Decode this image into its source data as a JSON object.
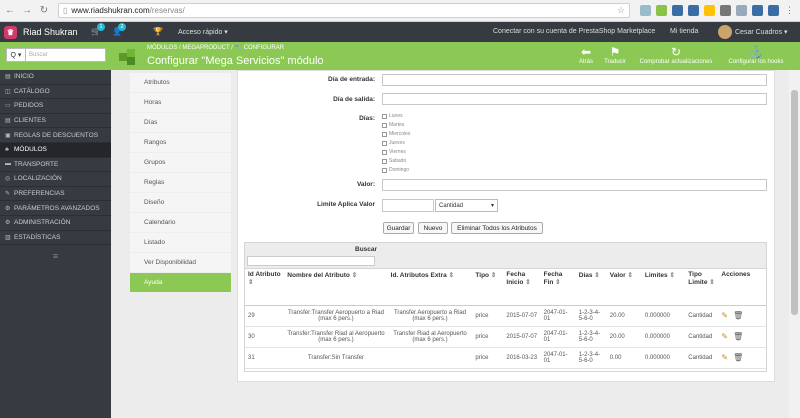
{
  "browser": {
    "url_host": "www.riadshukran.com",
    "url_path": "/reservas/"
  },
  "topbar": {
    "shop_name": "Riad Shukran",
    "cart_count": "1",
    "users_count": "2",
    "quick_access": "Acceso rápido ▾",
    "connect": "Conectar con su cuenta de PrestaShop Marketplace",
    "my_shop": "Mi tienda",
    "user_name": "Cesar Cuadros ▾"
  },
  "search": {
    "placeholder": "Buscar",
    "button": "Q ▾"
  },
  "breadcrumb": "MÓDULOS  /  MEGAPRODUCT  /  🔧 CONFIGURAR",
  "page_title": "Configurar \"Mega Servicios\" módulo",
  "toolbar": {
    "back": "Atrás",
    "translate": "Traducir",
    "check_updates": "Comprobar actualizaciones",
    "hooks": "Configurar los hooks"
  },
  "sidebar": [
    {
      "icon": "▤",
      "label": "INICIO"
    },
    {
      "icon": "◫",
      "label": "CATÁLOGO"
    },
    {
      "icon": "▭",
      "label": "PEDIDOS"
    },
    {
      "icon": "▤",
      "label": "CLIENTES"
    },
    {
      "icon": "▣",
      "label": "REGLAS DE DESCUENTOS"
    },
    {
      "icon": "♣",
      "label": "MÓDULOS"
    },
    {
      "icon": "▬",
      "label": "TRANSPORTE"
    },
    {
      "icon": "◎",
      "label": "LOCALIZACIÓN"
    },
    {
      "icon": "✎",
      "label": "PREFERENCIAS"
    },
    {
      "icon": "⚙",
      "label": "PARÁMETROS AVANZADOS"
    },
    {
      "icon": "⚙",
      "label": "ADMINISTRACIÓN"
    },
    {
      "icon": "▥",
      "label": "ESTADÍSTICAS"
    }
  ],
  "tabs": [
    "Atributos",
    "Horas",
    "Días",
    "Rangos",
    "Grupos",
    "Reglas",
    "Diseño",
    "Calendario",
    "Listado",
    "Ver Disponibilidad",
    "Ayuda"
  ],
  "form": {
    "fecha_entrada": "Día de entrada:",
    "fecha_salida": "Día de salida:",
    "dias": "Días:",
    "days": [
      "Lunes",
      "Martes",
      "Miercoles",
      "Jueves",
      "Viernes",
      "Sabado",
      "Domingo"
    ],
    "valor": "Valor:",
    "limite": "Limite Aplica Valor",
    "limite_select": "Cantidad"
  },
  "buttons": {
    "save": "Guardar",
    "new": "Nuevo",
    "delete_all": "Eliminar Todos los Atributos"
  },
  "table": {
    "search_label": "Buscar",
    "columns": [
      "Id Atributo",
      "Nombre del Atributo",
      "Id. Atributos Extra",
      "Tipo",
      "Fecha Inicio",
      "Fecha Fin",
      "Dias",
      "Valor",
      "Limites",
      "Tipo Limite",
      "Acciones"
    ],
    "rows": [
      [
        "29",
        "Transfer:Transfer Aeropuerto a Riad (max 6 pers.)",
        "Transfer Aeropuerto a Riad (max 6 pers.)",
        "price",
        "2015-07-07",
        "2047-01-01",
        "1-2-3-4-5-6-0",
        "20.00",
        "0.000000",
        "Cantidad"
      ],
      [
        "30",
        "Transfer:Transfer Riad al Aeropuerto (max 6 pers.)",
        "Transfer Riad al Aeropuerto (max 6 pers.)",
        "price",
        "2015-07-07",
        "2047-01-01",
        "1-2-3-4-5-6-0",
        "20.00",
        "0.000000",
        "Cantidad"
      ],
      [
        "31",
        "Transfer:Sin Transfer",
        "",
        "price",
        "2016-03-23",
        "2047-01-01",
        "1-2-3-4-5-6-0",
        "0.00",
        "0.000000",
        "Cantidad"
      ]
    ]
  }
}
